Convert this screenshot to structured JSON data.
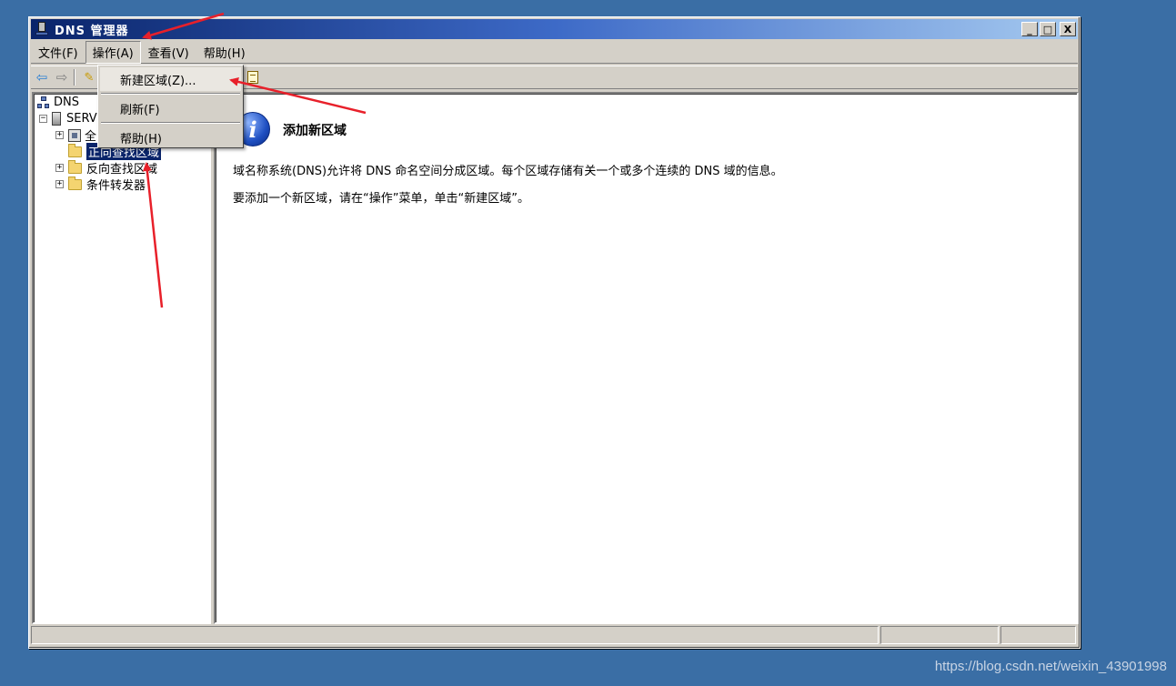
{
  "window": {
    "title": "DNS 管理器",
    "controls": {
      "minimize": "_",
      "maximize": "□",
      "close": "X"
    }
  },
  "menubar": [
    {
      "label": "文件(F)"
    },
    {
      "label": "操作(A)"
    },
    {
      "label": "查看(V)"
    },
    {
      "label": "帮助(H)"
    }
  ],
  "action_menu": {
    "items": [
      "新建区域(Z)...",
      "刷新(F)",
      "帮助(H)"
    ]
  },
  "tree": {
    "root": "DNS",
    "server": "SERV",
    "global_logs": "全",
    "forward_zones": "正向查找区域",
    "reverse_zones": "反向查找区域",
    "conditional_forwarders": "条件转发器"
  },
  "content": {
    "heading": "添加新区域",
    "para1": "域名称系统(DNS)允许将 DNS 命名空间分成区域。每个区域存储有关一个或多个连续的 DNS 域的信息。",
    "para2": "要添加一个新区域，请在“操作”菜单，单击“新建区域”。"
  },
  "watermark": "https://blog.csdn.net/weixin_43901998",
  "colors": {
    "desktop": "#3a6ea5",
    "titlebar_start": "#0a246a",
    "titlebar_end": "#a6caf0",
    "selection": "#0a246a",
    "annotation_arrow": "#e8202a"
  }
}
